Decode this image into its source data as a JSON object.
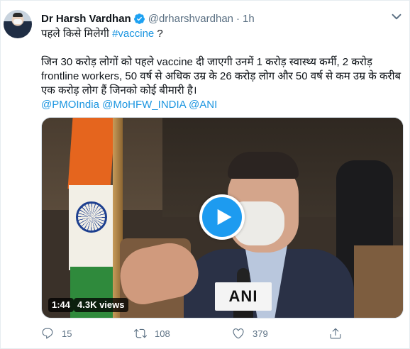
{
  "author": {
    "name": "Dr Harsh Vardhan",
    "handle": "@drharshvardhan",
    "separator": "·",
    "time": "1h"
  },
  "tweet": {
    "line1_prefix": "पहले किसे मिलेगी ",
    "line1_hashtag": "#vaccine",
    "line1_suffix": " ?",
    "paragraph": "जिन 30 करोड़ लोगों को पहले vaccine दी जाएगी उनमें 1 करोड़ स्वास्थ्य कर्मी, 2 करोड़ frontline workers, 50 वर्ष से अधिक उम्र के 26 करोड़ लोग और 50 वर्ष से कम उम्र के करीब एक करोड़ लोग हैं जिनको कोई बीमारी है।",
    "mentions": [
      "@PMOIndia",
      "@MoHFW_INDIA",
      "@ANI"
    ]
  },
  "video": {
    "duration": "1:44",
    "views": "4.3K views",
    "mic_logo_text": "ANI"
  },
  "actions": {
    "replies": "15",
    "retweets": "108",
    "likes": "379"
  },
  "colors": {
    "link": "#1b95e0",
    "secondary_text": "#5b7083",
    "play_button": "#1d9bf0",
    "verified": "#1da1f2"
  },
  "icons": {
    "verified": "verified-badge-icon",
    "more": "more-icon",
    "play": "play-icon",
    "reply": "reply-icon",
    "retweet": "retweet-icon",
    "like": "heart-icon",
    "share": "share-icon"
  }
}
